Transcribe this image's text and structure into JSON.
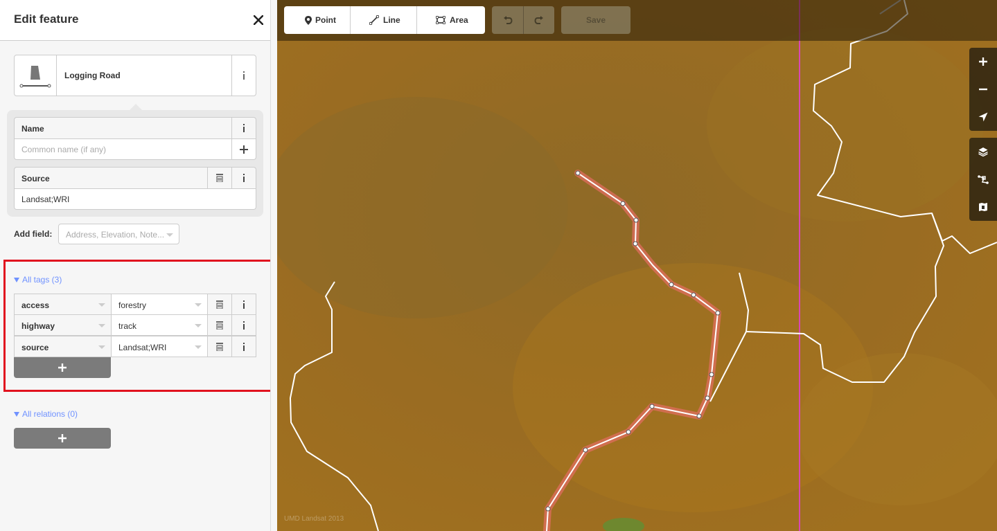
{
  "sidebar": {
    "title": "Edit feature",
    "preset": {
      "name": "Logging Road"
    },
    "fields": {
      "name": {
        "label": "Name",
        "placeholder": "Common name (if any)"
      },
      "source": {
        "label": "Source",
        "value": "Landsat;WRI"
      }
    },
    "add_field": {
      "label": "Add field:",
      "placeholder": "Address, Elevation, Note..."
    },
    "all_tags": {
      "label": "All tags (3)",
      "rows": [
        {
          "key": "access",
          "value": "forestry"
        },
        {
          "key": "highway",
          "value": "track"
        },
        {
          "key": "source",
          "value": "Landsat;WRI"
        }
      ]
    },
    "all_relations": {
      "label": "All relations (0)"
    }
  },
  "toolbar": {
    "modes": [
      {
        "label": "Point",
        "icon": "point-icon"
      },
      {
        "label": "Line",
        "icon": "line-icon"
      },
      {
        "label": "Area",
        "icon": "area-icon"
      }
    ],
    "save_label": "Save"
  },
  "map": {
    "attribution": "UMD Landsat 2013",
    "map_controls": [
      "zoom-in-icon",
      "zoom-out-icon",
      "geolocate-icon",
      "layers-icon",
      "map-data-icon",
      "help-icon"
    ],
    "colors": {
      "selected_way": "#e06e5f",
      "way": "#ffffff",
      "boundary": "#d946b5",
      "highlight": "#e1131f",
      "link": "#7092ff"
    }
  }
}
